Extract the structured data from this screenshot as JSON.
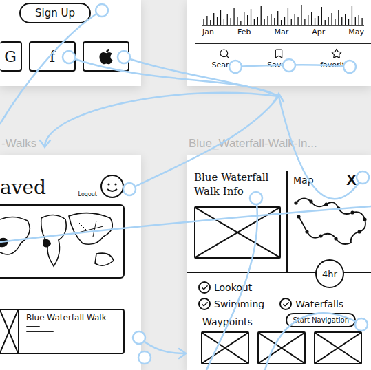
{
  "signup": {
    "button": "Sign Up",
    "social": [
      {
        "kind": "letter",
        "label": "G"
      },
      {
        "kind": "letter",
        "label": "f"
      },
      {
        "kind": "apple"
      }
    ]
  },
  "chart": {
    "months": [
      "Jan",
      "Feb",
      "Mar",
      "Apr",
      "May"
    ],
    "values": [
      10,
      14,
      8,
      18,
      12,
      22,
      9,
      16,
      11,
      26,
      13,
      7,
      19,
      15,
      24,
      10,
      12,
      28,
      9,
      14,
      17,
      11,
      21,
      8,
      13,
      25,
      10,
      16,
      12,
      30,
      9,
      15,
      20,
      11,
      14,
      27,
      8,
      12,
      18,
      10,
      23,
      13,
      16,
      9,
      29,
      12,
      15,
      11
    ]
  },
  "nav": [
    {
      "label": "Search"
    },
    {
      "label": "Saved"
    },
    {
      "label": "favorites"
    }
  ],
  "artboard_labels": [
    "-Walks",
    "Blue_Waterfall-Walk-In..."
  ],
  "saved": {
    "title": "aved",
    "logout": "Logout",
    "card_title": "Blue Waterfall Walk"
  },
  "info": {
    "title": "Blue Waterfall Walk Info",
    "map_label": "Map",
    "close": "X",
    "duration": "4hr",
    "features": [
      {
        "label": "Lookout",
        "checked": true
      },
      {
        "label": "Swimming",
        "checked": true
      },
      {
        "label": "Waterfalls",
        "checked": true
      }
    ],
    "start_button": "Start Navigation",
    "waypoints_label": "Waypoints"
  }
}
